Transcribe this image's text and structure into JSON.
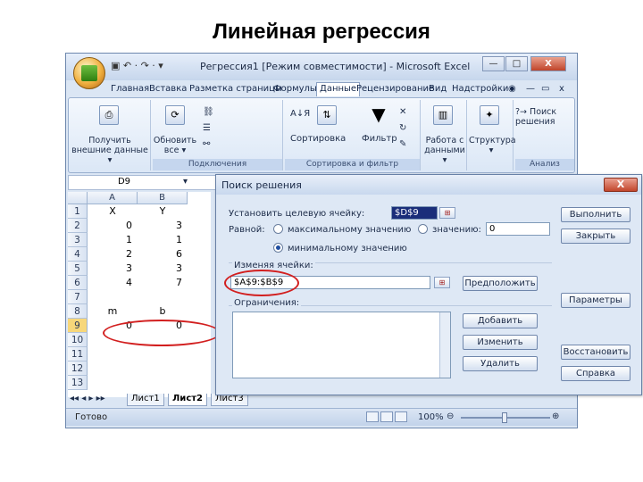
{
  "slide_title": "Линейная регрессия",
  "window": {
    "app_title": "Регрессия1 [Режим совместимости] - Microsoft Excel",
    "qat": "▣ ↶ · ↷ · ▾",
    "minimize": "—",
    "restore": "□",
    "close": "X",
    "ribbon_help": "◉",
    "ribbon_min": "—",
    "ribbon_restore": "▭",
    "ribbon_close": "x"
  },
  "tabs": [
    "Главная",
    "Вставка",
    "Разметка страницы",
    "Формулы",
    "Данные",
    "Рецензирование",
    "Вид",
    "Надстройки"
  ],
  "ribbon": {
    "get_external": "Получить внешние данные ▾",
    "refresh_all": "Обновить все ▾",
    "connections_label": "Подключения",
    "sort_az": "А↓Я",
    "sort_btn": "Сортировка",
    "filter_btn": "Фильтр",
    "sort_filter_label": "Сортировка и фильтр",
    "data_tools": "Работа с данными ▾",
    "structure": "Структура ▾",
    "solver": "Поиск решения",
    "analysis_label": "Анализ"
  },
  "formula_bar": {
    "name_box": "D9",
    "dropdown": "▾"
  },
  "grid": {
    "columns": [
      "A",
      "B"
    ],
    "rows": [
      {
        "n": "1",
        "a": "X",
        "b": "Y"
      },
      {
        "n": "2",
        "a": "0",
        "b": "3"
      },
      {
        "n": "3",
        "a": "1",
        "b": "1"
      },
      {
        "n": "4",
        "a": "2",
        "b": "6"
      },
      {
        "n": "5",
        "a": "3",
        "b": "3"
      },
      {
        "n": "6",
        "a": "4",
        "b": "7"
      },
      {
        "n": "7",
        "a": "",
        "b": ""
      },
      {
        "n": "8",
        "a": "m",
        "b": "b"
      },
      {
        "n": "9",
        "a": "0",
        "b": "0"
      },
      {
        "n": "10",
        "a": "",
        "b": ""
      },
      {
        "n": "11",
        "a": "",
        "b": ""
      },
      {
        "n": "12",
        "a": "",
        "b": ""
      },
      {
        "n": "13",
        "a": "",
        "b": ""
      }
    ]
  },
  "sheet_tabs": [
    "Лист1",
    "Лист2",
    "Лист3"
  ],
  "sheet_nav": "◂◂ ◂ ▸ ▸▸",
  "status": {
    "ready": "Готово",
    "zoom": "100%",
    "minus": "⊖",
    "plus": "⊕"
  },
  "dialog": {
    "title": "Поиск решения",
    "close": "X",
    "target_label": "Установить целевую ячейку:",
    "target_value": "$D$9",
    "equal_label": "Равной:",
    "max_label": "максимальному значению",
    "value_label": "значению:",
    "value_field": "0",
    "min_label": "минимальному значению",
    "changing_label": "Изменяя ячейки:",
    "changing_value": "$A$9:$B$9",
    "guess": "Предположить",
    "constraints_label": "Ограничения:",
    "add": "Добавить",
    "change": "Изменить",
    "delete": "Удалить",
    "solve": "Выполнить",
    "close_btn": "Закрыть",
    "options": "Параметры",
    "reset": "Восстановить",
    "help": "Справка"
  }
}
